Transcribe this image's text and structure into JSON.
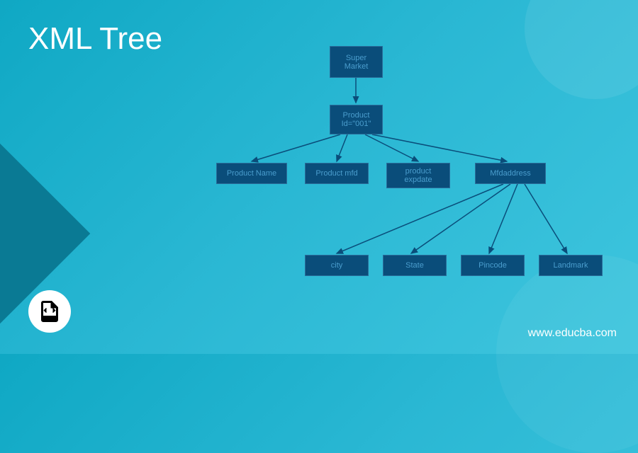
{
  "title": "XML Tree",
  "site_url": "www.educba.com",
  "icon_label": "XML",
  "tree": {
    "root": {
      "line1": "Super",
      "line2": "Market"
    },
    "level1": {
      "line1": "Product",
      "line2": "Id=\"001\""
    },
    "level2": [
      {
        "label": "Product Name"
      },
      {
        "label": "Product mfd"
      },
      {
        "label_line1": "product",
        "label_line2": "expdate"
      },
      {
        "label": "Mfdaddress"
      }
    ],
    "level3": [
      {
        "label": "city"
      },
      {
        "label": "State"
      },
      {
        "label": "Pincode"
      },
      {
        "label": "Landmark"
      }
    ]
  }
}
